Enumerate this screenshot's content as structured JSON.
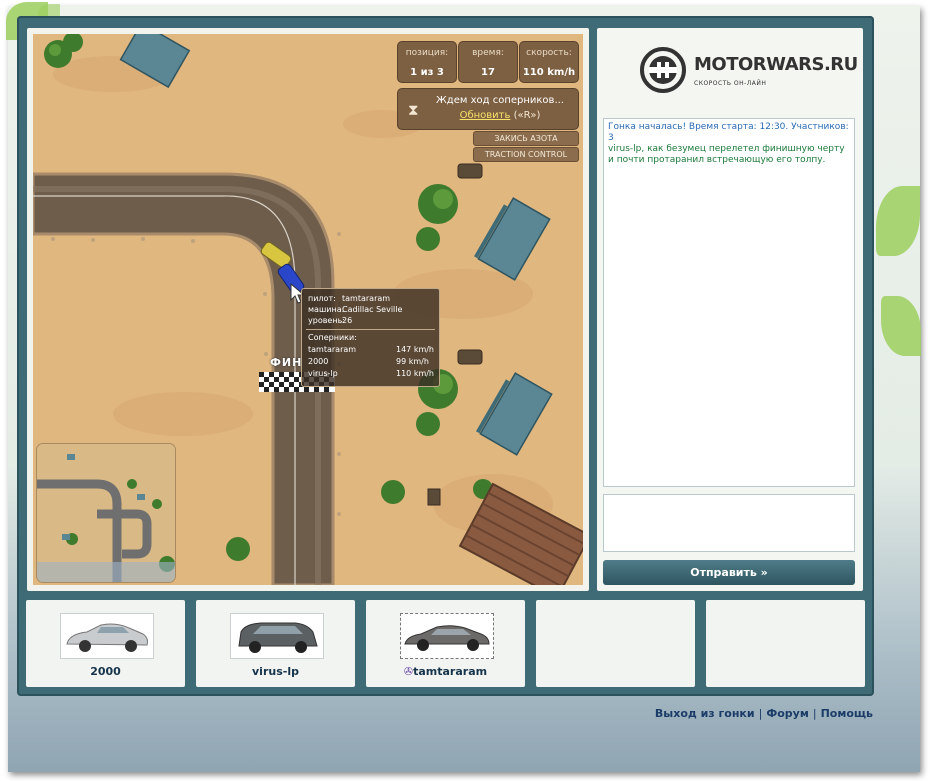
{
  "logo": {
    "title": "MOTORWARS.RU",
    "subtitle": "СКОРОСТЬ ОН-ЛАЙН"
  },
  "hud": {
    "position": {
      "label": "позиция:",
      "value": "1 из 3"
    },
    "time": {
      "label": "время:",
      "value": "17"
    },
    "speed": {
      "label": "скорость:",
      "value": "110 km/h"
    }
  },
  "waiting": {
    "text": "Ждем ход соперников...",
    "refresh": "Обновить",
    "hotkey": "(«R»)"
  },
  "buttons": {
    "nitro": "ЗАКИСЬ АЗОТА",
    "traction": "TRACTION CONTROL",
    "send": "Отправить »"
  },
  "tooltip": {
    "pilot_label": "пилот:",
    "pilot": "tamtararam",
    "car_label": "машина:",
    "car": "Cadillac Seville",
    "level_label": "уровень:",
    "level": "26",
    "rivals_label": "Соперники:",
    "rivals": [
      {
        "name": "tamtararam",
        "speed": "147 km/h"
      },
      {
        "name": "2000",
        "speed": "99 km/h"
      },
      {
        "name": "virus-lp",
        "speed": "110 km/h"
      }
    ]
  },
  "track": {
    "finish_label": "ФИН"
  },
  "chat": {
    "messages": [
      {
        "type": "sys",
        "text": "Гонка началась! Время старта: 12:30. Участников: 3"
      },
      {
        "type": "user",
        "text": "virus-lp, как безумец перелетел финишную черту и почти протаранил встречающую его толпу."
      }
    ]
  },
  "players": [
    {
      "name": "2000",
      "car_color": "#c9cccf"
    },
    {
      "name": "virus-lp",
      "car_color": "#5b6063"
    },
    {
      "name": "tamtararam",
      "car_color": "#6c6a68",
      "selected": true
    }
  ],
  "footer": {
    "exit": "Выход из гонки",
    "forum": "Форум",
    "help": "Помощь"
  }
}
